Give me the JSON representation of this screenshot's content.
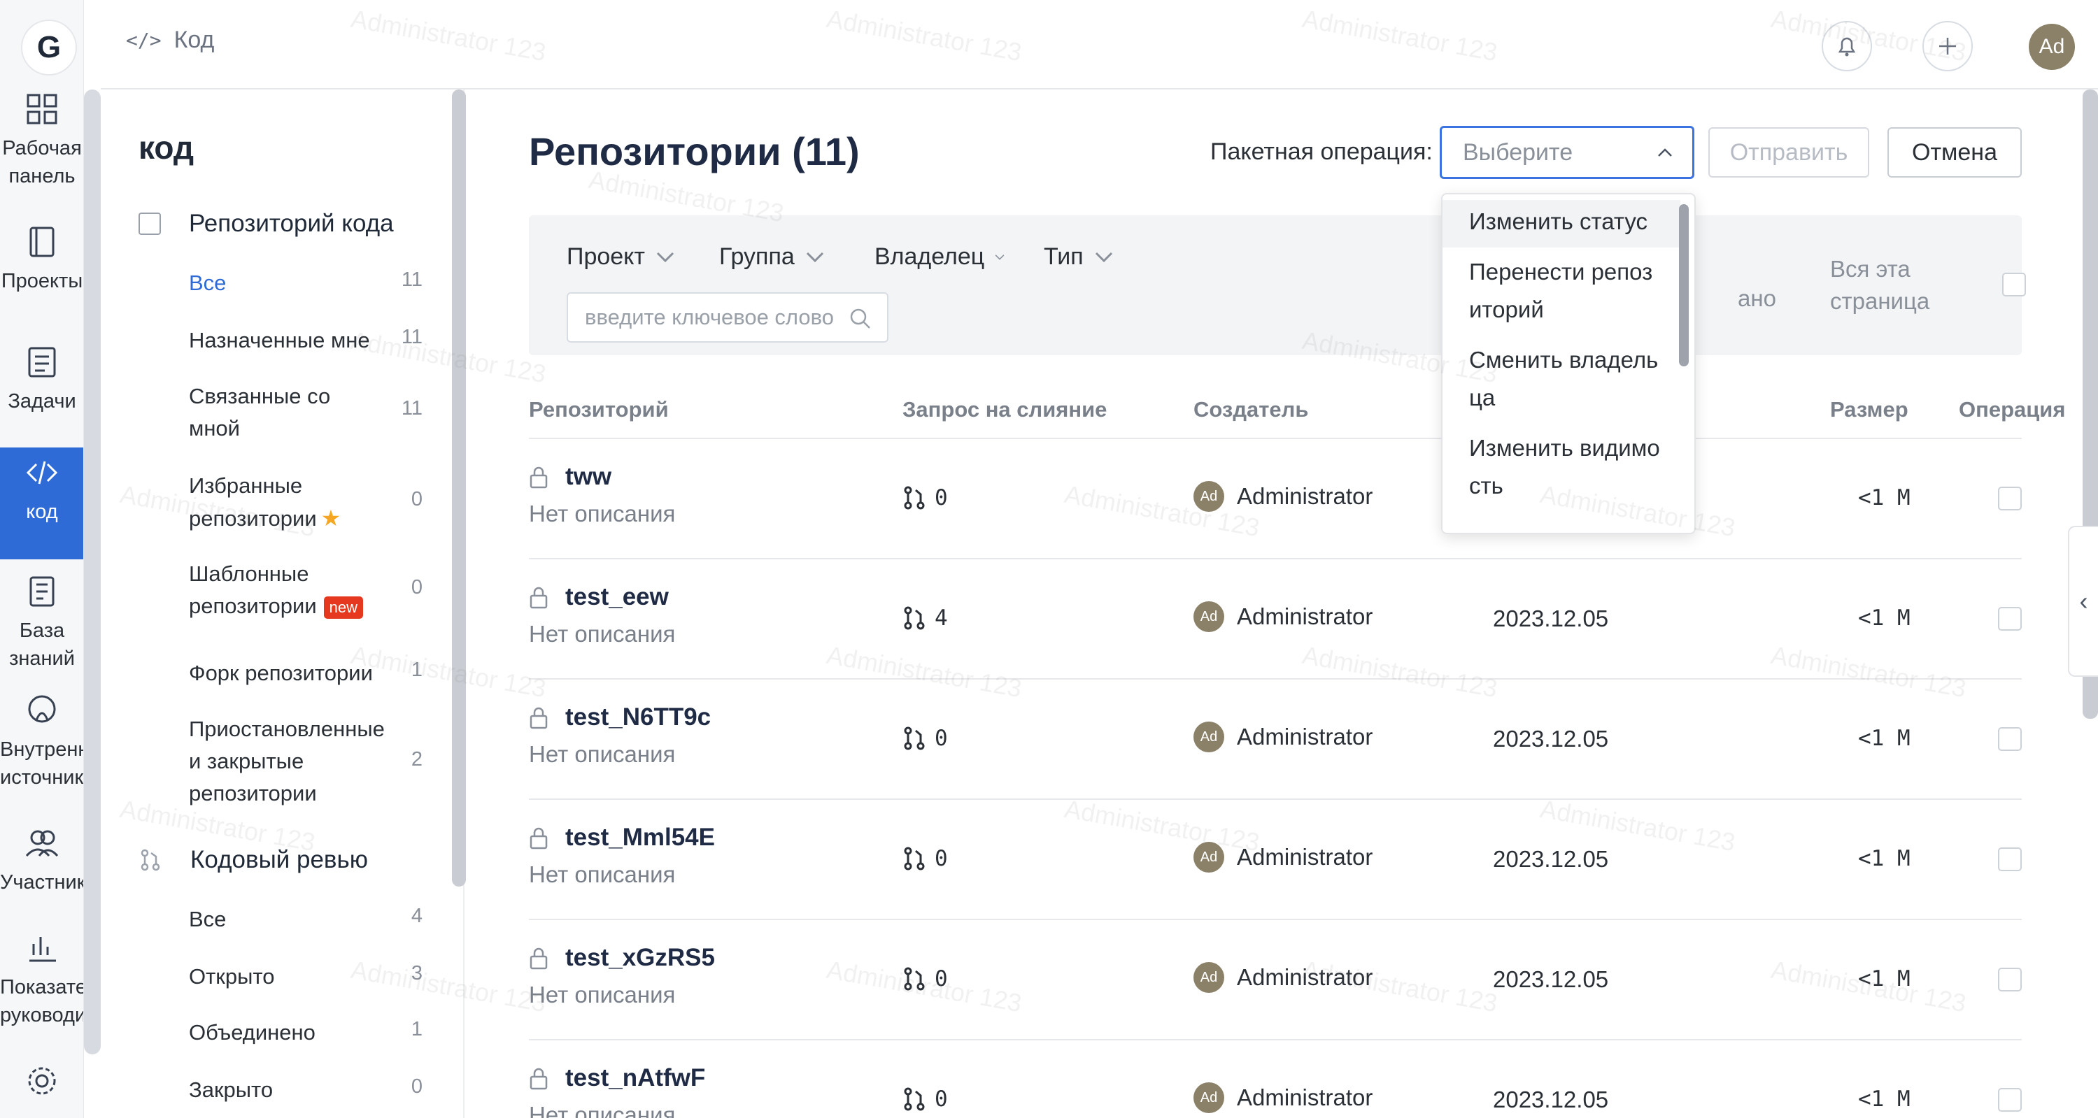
{
  "rail": {
    "logo": "G",
    "items": [
      {
        "label": "Рабочая панель",
        "icon": "dashboard-icon"
      },
      {
        "label": "Проекты",
        "icon": "book-icon"
      },
      {
        "label": "Задачи",
        "icon": "tasks-icon"
      },
      {
        "label": "код",
        "icon": "code-icon",
        "active": true
      },
      {
        "label": "База знаний",
        "icon": "knowledge-icon"
      },
      {
        "label": "Внутренние источники",
        "icon": "source-icon"
      },
      {
        "label": "Участники",
        "icon": "members-icon"
      },
      {
        "label": "Показатели руководителя",
        "icon": "chart-icon"
      }
    ]
  },
  "topbar": {
    "breadcrumb": "Код",
    "avatar": "Ad"
  },
  "sidebar": {
    "title": "код",
    "group1": "Репозиторий кода",
    "items1": [
      {
        "label": "Все",
        "count": "11"
      },
      {
        "label": "Назначенные мне",
        "count": "11"
      },
      {
        "label": "Связанные со мной",
        "count": "11"
      },
      {
        "label": "Избранные репозитории",
        "count": "0"
      },
      {
        "label": "Шаблонные репозитории",
        "count": "0",
        "badge": "new"
      },
      {
        "label": "Форк репозитории",
        "count": "1"
      },
      {
        "label": "Приостановленные и закрытые репозитории",
        "count": "2"
      }
    ],
    "group2": "Кодовый ревью",
    "items2": [
      {
        "label": "Все",
        "count": "4"
      },
      {
        "label": "Открыто",
        "count": "3"
      },
      {
        "label": "Объединено",
        "count": "1"
      },
      {
        "label": "Закрыто",
        "count": "0"
      }
    ]
  },
  "main": {
    "title": "Репозитории (11)",
    "batch_label": "Пакетная операция:",
    "select_placeholder": "Выберите",
    "submit": "Отправить",
    "cancel": "Отмена",
    "filters": [
      "Проект",
      "Группа",
      "Владелец",
      "Тип"
    ],
    "search_placeholder": "введите ключевое слово",
    "stub": "ано",
    "whole_page": "Вся эта страница",
    "columns": [
      "Репозиторий",
      "Запрос на слияние",
      "Создатель",
      "Размер",
      "Операция"
    ],
    "rows": [
      {
        "name": "tww",
        "desc": "Нет описания",
        "mr": "0",
        "creator": "Administrator",
        "date": "",
        "size": "<1 M"
      },
      {
        "name": "test_eew",
        "desc": "Нет описания",
        "mr": "4",
        "creator": "Administrator",
        "date": "2023.12.05",
        "size": "<1 M"
      },
      {
        "name": "test_N6TT9c",
        "desc": "Нет описания",
        "mr": "0",
        "creator": "Administrator",
        "date": "2023.12.05",
        "size": "<1 M"
      },
      {
        "name": "test_Mml54E",
        "desc": "Нет описания",
        "mr": "0",
        "creator": "Administrator",
        "date": "2023.12.05",
        "size": "<1 M"
      },
      {
        "name": "test_xGzRS5",
        "desc": "Нет описания",
        "mr": "0",
        "creator": "Administrator",
        "date": "2023.12.05",
        "size": "<1 M"
      },
      {
        "name": "test_nAtfwF",
        "desc": "Нет описания",
        "mr": "0",
        "creator": "Administrator",
        "date": "2023.12.05",
        "size": "<1 M"
      }
    ],
    "avatar_initials": "Ad"
  },
  "dropdown": {
    "options": [
      "Изменить статус",
      "Перенести репоз иторий",
      "Сменить владель ца",
      "Изменить видимо сть"
    ]
  },
  "watermark": "Administrator 123",
  "colors": {
    "accent": "#2f6bd6",
    "badge": "#e5381e",
    "star": "#f5a623"
  }
}
